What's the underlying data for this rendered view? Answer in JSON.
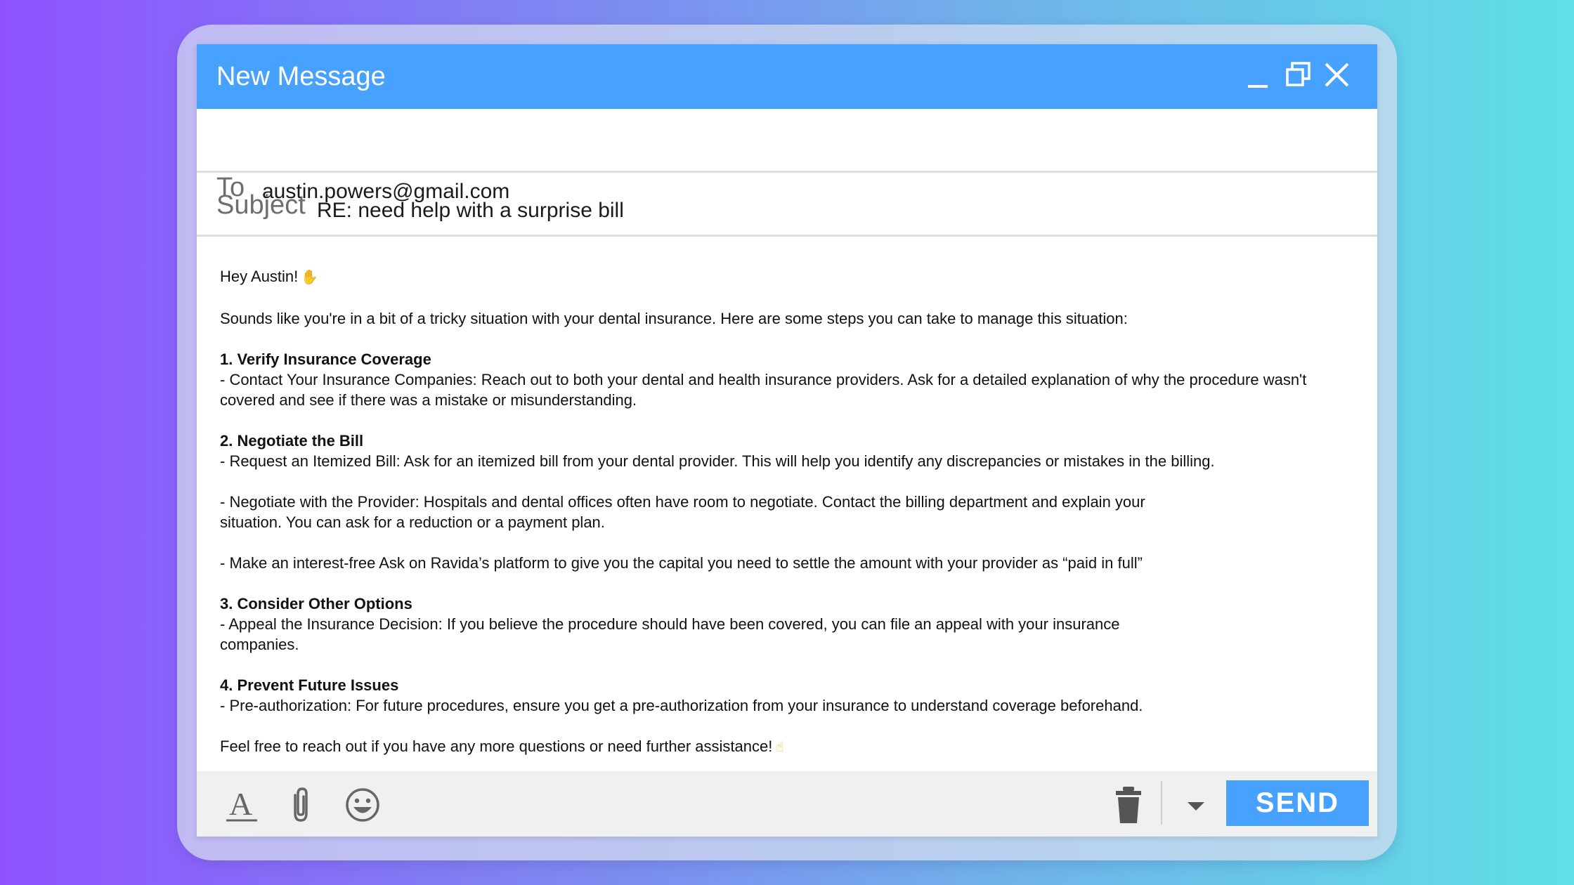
{
  "window": {
    "title": "New Message"
  },
  "to": {
    "label": "To",
    "value": "austin.powers@gmail.com"
  },
  "subject": {
    "label": "Subject",
    "value": "RE: need help with a surprise bill"
  },
  "body": {
    "greeting": "Hey Austin!",
    "intro": "Sounds like you're in a bit of a tricky situation with your dental insurance. Here are some steps you can take to manage this situation:",
    "s1_heading": "1. Verify Insurance Coverage",
    "s1_line1": "- Contact Your Insurance Companies: Reach out to both your dental and health insurance providers. Ask for a detailed explanation of why the procedure wasn't",
    "s1_line2": "covered and see if there was a mistake or misunderstanding.",
    "s2_heading": "2. Negotiate the Bill",
    "s2_line1": "- Request an Itemized Bill: Ask for an itemized bill from your dental provider. This will help you identify any discrepancies or mistakes in the billing.",
    "s2_line2": "- Negotiate with the Provider: Hospitals and dental offices often have room to negotiate. Contact the billing department and explain your",
    "s2_line3": "situation. You can ask for a reduction or a payment plan.",
    "s2_line4": "- Make an interest-free Ask on Ravida’s platform to give you the capital you need to settle the amount with your provider as “paid in full”",
    "s3_heading": "3. Consider Other Options",
    "s3_line1": "- Appeal the Insurance Decision: If you believe the procedure should have been covered, you can file an appeal with your insurance",
    "s3_line2": "companies.",
    "s4_heading": "4. Prevent Future Issues",
    "s4_line1": "- Pre-authorization: For future procedures, ensure you get a pre-authorization from your insurance to understand coverage beforehand.",
    "closing": "Feel free to reach out if you have any more questions or need further assistance!"
  },
  "footer": {
    "send_label": "SEND"
  },
  "icons": {
    "greeting_emoji": "waving-hand-icon",
    "closing_emoji": "call-me-hand-icon"
  },
  "colors": {
    "accent": "#46a1ff",
    "footer_bg": "#f0f0f0"
  }
}
